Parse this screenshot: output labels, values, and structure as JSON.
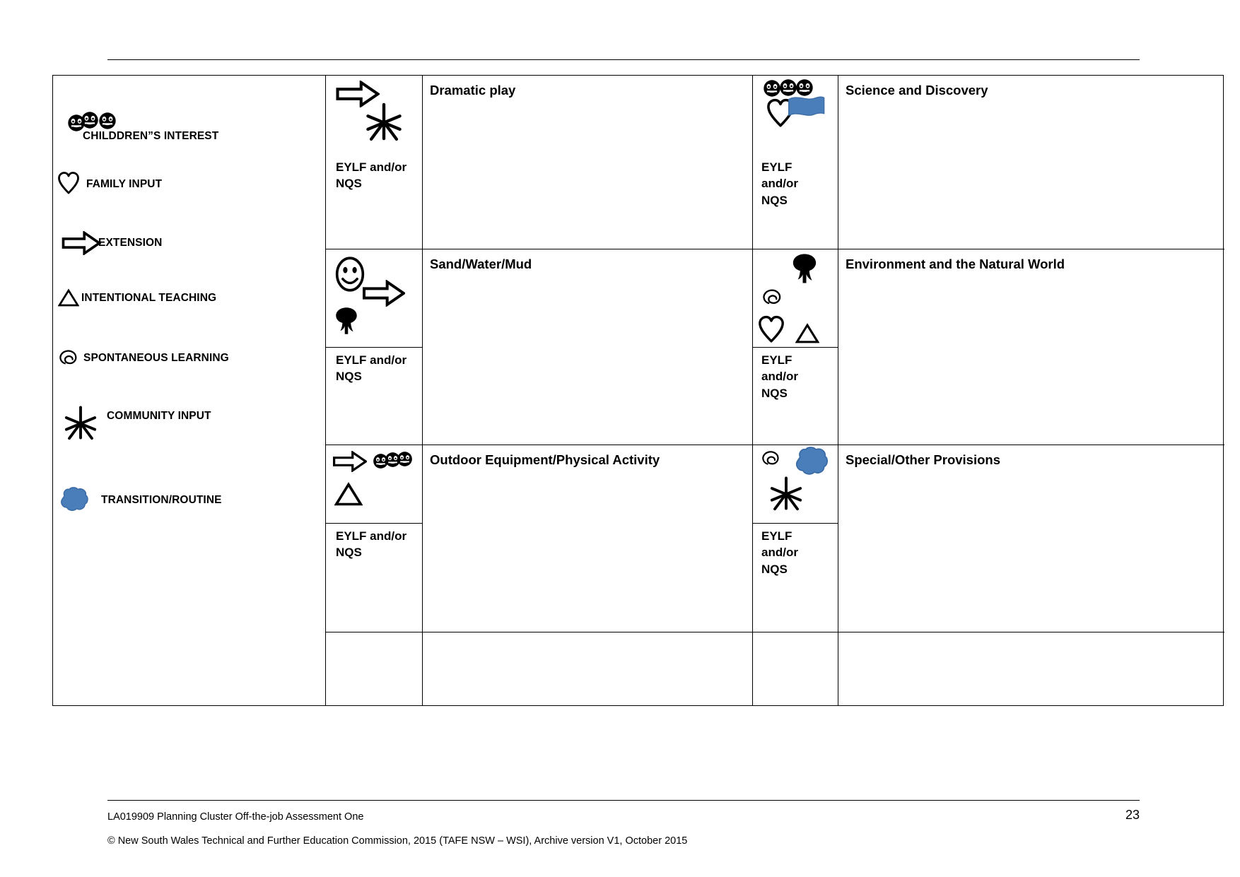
{
  "document": {
    "legend": {
      "items": [
        {
          "icon": "three-faces-icon",
          "label": "CHILDDREN”S INTEREST"
        },
        {
          "icon": "heart-icon",
          "label": "FAMILY INPUT"
        },
        {
          "icon": "arrow-right-icon",
          "label": "EXTENSION"
        },
        {
          "icon": "triangle-icon",
          "label": "INTENTIONAL  TEACHING"
        },
        {
          "icon": "spiral-icon",
          "label": "SPONTANEOUS LEARNING"
        },
        {
          "icon": "star-icon",
          "label": "COMMUNITY INPUT"
        },
        {
          "icon": "blue-blob-icon",
          "label": "TRANSITION/ROUTINE"
        }
      ]
    },
    "eylf_label": "EYLF and/or\nNQS",
    "eylf_label_narrow": "EYLF\nand/or\nNQS",
    "rows": [
      {
        "left": {
          "icons": [
            "arrow-right-icon",
            "star-icon"
          ],
          "eylf": "EYLF and/or\nNQS",
          "topic": "Dramatic play"
        },
        "right": {
          "icons": [
            "three-faces-icon",
            "heart-icon",
            "blue-flag-icon"
          ],
          "eylf": "EYLF\nand/or\nNQS",
          "topic": "Science and Discovery"
        }
      },
      {
        "left": {
          "icons": [
            "smiley-face-icon",
            "arrow-right-icon",
            "tree-icon"
          ],
          "eylf": "EYLF and/or\nNQS",
          "topic": "Sand/Water/Mud"
        },
        "right": {
          "icons": [
            "tree-icon",
            "spiral-icon",
            "heart-icon",
            "triangle-icon"
          ],
          "eylf": "EYLF\nand/or\nNQS",
          "topic": "Environment and the Natural World"
        }
      },
      {
        "left": {
          "icons": [
            "arrow-right-icon",
            "three-faces-icon",
            "triangle-icon"
          ],
          "eylf": "EYLF and/or\nNQS",
          "topic": "Outdoor Equipment/Physical Activity"
        },
        "right": {
          "icons": [
            "spiral-icon",
            "blue-blob-icon",
            "star-icon"
          ],
          "eylf": "EYLF\nand/or\nNQS",
          "topic": "Special/Other Provisions"
        }
      }
    ],
    "footer": {
      "line1": "LA019909 Planning Cluster  Off-the-job Assessment One",
      "page_number": "23",
      "line2": "© New South Wales Technical and Further Education Commission, 2015 (TAFE NSW – WSI), Archive version V1, October 2015"
    },
    "colors": {
      "blue": "#4a7ebb",
      "blue_dark": "#3a6ba5",
      "ink": "#000000"
    }
  }
}
